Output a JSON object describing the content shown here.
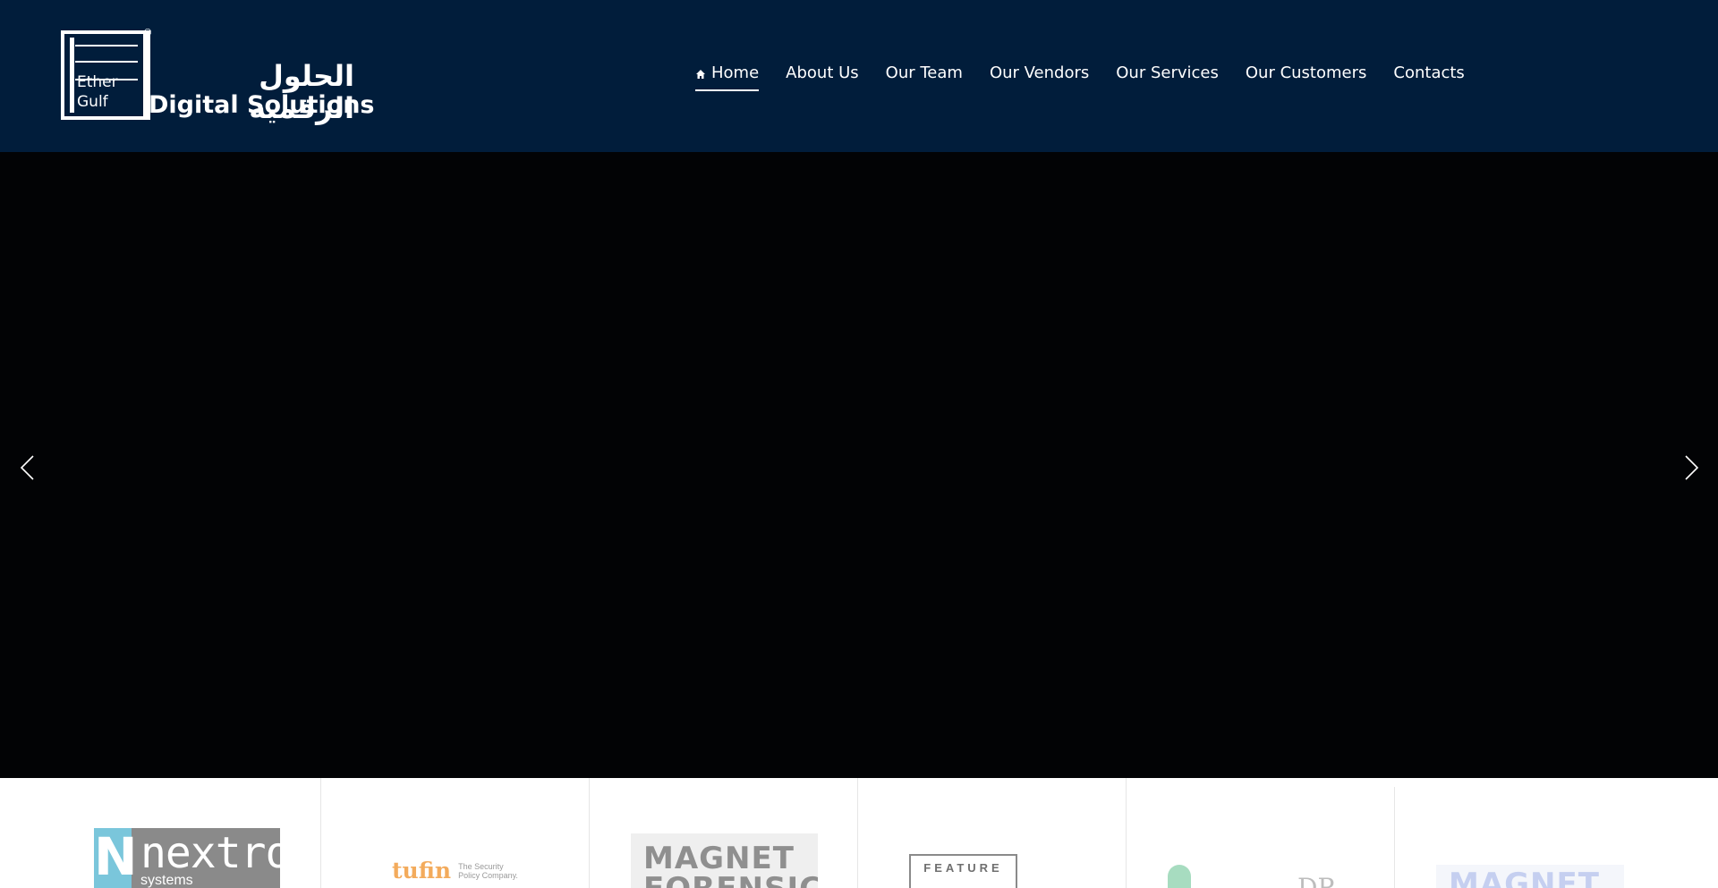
{
  "header": {
    "logo": {
      "arabic_name": "الحلول الرقمية",
      "english_name": "Digital Solutions",
      "mark_lines": [
        "Ether",
        "Gulf"
      ],
      "registered": "®"
    },
    "nav": [
      {
        "label": "Home",
        "active": true,
        "icon": "home-icon"
      },
      {
        "label": "About Us",
        "active": false
      },
      {
        "label": "Our Team",
        "active": false
      },
      {
        "label": "Our Vendors",
        "active": false
      },
      {
        "label": "Our Services",
        "active": false
      },
      {
        "label": "Our Customers",
        "active": false
      },
      {
        "label": "Contacts",
        "active": false
      }
    ],
    "background_color": "#011d3b"
  },
  "hero": {
    "background_color": "#020305",
    "prev_icon": "chevron-left-icon",
    "next_icon": "chevron-right-icon"
  },
  "vendors": [
    {
      "name": "nextron",
      "text": "nextron",
      "sub": "systems"
    },
    {
      "name": "tufin",
      "text": "tufin",
      "tagline": "The Security Policy Company."
    },
    {
      "name": "magnet-forensics",
      "line1": "MAGNET",
      "line2": "FORENSICS",
      "mark": "®"
    },
    {
      "name": "feature",
      "text": "FEATURE"
    },
    {
      "name": "dp",
      "text": "DP"
    },
    {
      "name": "magnet",
      "text": "MAGNET"
    }
  ]
}
